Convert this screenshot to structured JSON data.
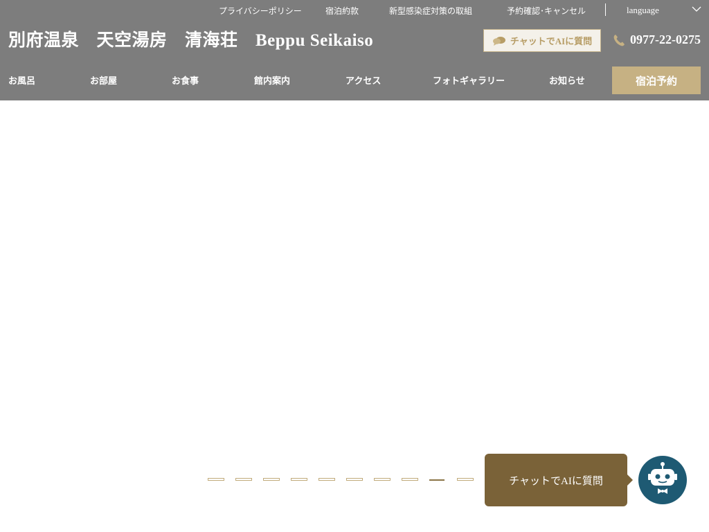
{
  "utility_links": [
    {
      "label": "プライバシーポリシー"
    },
    {
      "label": "宿泊約款"
    },
    {
      "label": "新型感染症対策の取組"
    },
    {
      "label": "予約確認･キャンセル"
    }
  ],
  "language": {
    "label": "language",
    "icon": "chevron-down-icon"
  },
  "site": {
    "title": "別府温泉　天空湯房　清海荘　Beppu Seikaiso"
  },
  "chat_ai_button": {
    "label": "チャットでAIに質問",
    "icon": "chat-bubbles-icon"
  },
  "phone": {
    "number": "0977-22-0275",
    "icon": "phone-icon"
  },
  "nav": {
    "items": [
      {
        "label": "お風呂"
      },
      {
        "label": "お部屋"
      },
      {
        "label": "お食事"
      },
      {
        "label": "館内案内"
      },
      {
        "label": "アクセス"
      },
      {
        "label": "フォトギャラリー"
      },
      {
        "label": "お知らせ"
      }
    ],
    "reserve_label": "宿泊予約"
  },
  "slider": {
    "count": 10,
    "active_index": 8
  },
  "chat_widget": {
    "label": "チャットでAIに質問",
    "icon": "robot-icon"
  },
  "colors": {
    "header_bg": "#7d7d7d",
    "accent_gold": "#c6b183",
    "chat_brown": "#7a6238",
    "robot_blue": "#1e5a73"
  }
}
